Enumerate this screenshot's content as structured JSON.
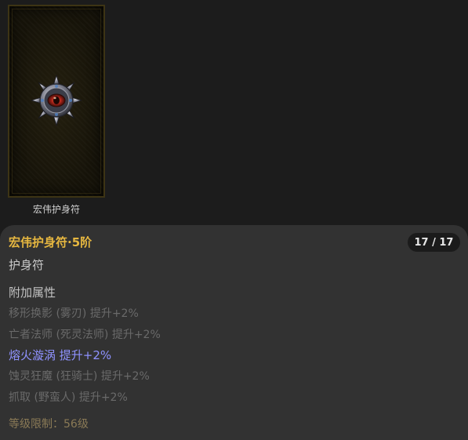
{
  "item": {
    "caption": "宏伟护身符",
    "icon": "amulet-icon"
  },
  "tooltip": {
    "title": "宏伟护身符·5阶",
    "count": "17 / 17",
    "type": "护身符",
    "section_title": "附加属性",
    "attributes": [
      {
        "text": "移形换影 (雾刃) 提升+2%",
        "active": false
      },
      {
        "text": "亡者法师 (死灵法师) 提升+2%",
        "active": false
      },
      {
        "text": "熔火漩涡 提升+2%",
        "active": true
      },
      {
        "text": "蚀灵狂魔 (狂骑士) 提升+2%",
        "active": false
      },
      {
        "text": "抓取 (野蛮人) 提升+2%",
        "active": false
      }
    ],
    "level_requirement": "等级限制：56级"
  },
  "colors": {
    "title": "#e6b740",
    "active_attribute": "#8f92ff",
    "inactive_attribute": "#6a6a6a",
    "panel": "#323232",
    "background": "#1c1c1c"
  }
}
